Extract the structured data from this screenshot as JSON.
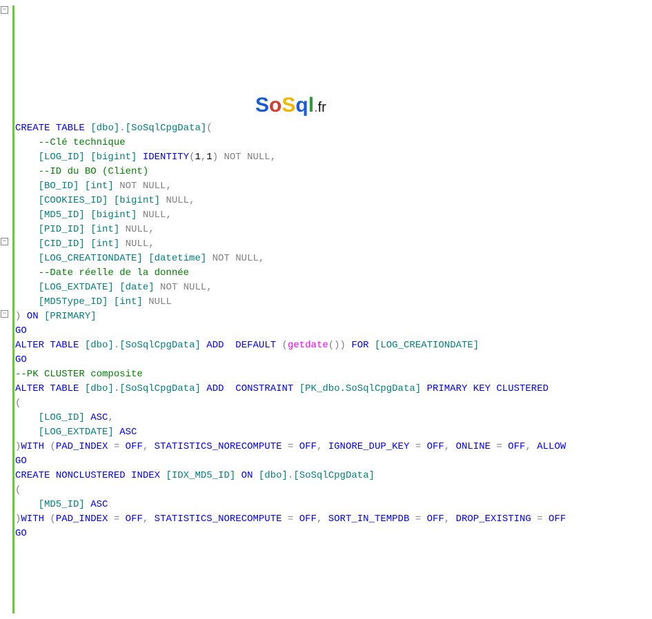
{
  "logo": {
    "s1": "S",
    "o": "o",
    "s2": "S",
    "q": "q",
    "l": "l",
    "dot": ".",
    "fr": "fr"
  },
  "code": {
    "l1a": "CREATE",
    "l1b": " TABLE",
    "l1c": " [dbo]",
    "l1d": ".",
    "l1e": "[SoSqlCpgData]",
    "l1f": "(",
    "l2": "    --Clé technique",
    "l3a": "    [LOG_ID] [bigint]",
    "l3b": " IDENTITY",
    "l3c": "(",
    "l3d": "1",
    "l3e": ",",
    "l3f": "1",
    "l3g": ")",
    "l3h": " NOT",
    "l3i": " NULL",
    "l3j": ",",
    "l4": "    --ID du BO (Client)",
    "l5a": "    [BO_ID] [int]",
    "l5b": " NOT",
    "l5c": " NULL",
    "l5d": ",",
    "l6a": "    [COOKIES_ID] [bigint]",
    "l6b": " NULL",
    "l6c": ",",
    "l7a": "    [MD5_ID] [bigint]",
    "l7b": " NULL",
    "l7c": ",",
    "l8a": "    [PID_ID] [int]",
    "l8b": " NULL",
    "l8c": ",",
    "l9a": "    [CID_ID] [int]",
    "l9b": " NULL",
    "l9c": ",",
    "l10a": "    [LOG_CREATIONDATE] [datetime]",
    "l10b": " NOT",
    "l10c": " NULL",
    "l10d": ",",
    "l11": "    --Date réelle de la donnée",
    "l12a": "    [LOG_EXTDATE] [date]",
    "l12b": " NOT",
    "l12c": " NULL",
    "l12d": ",",
    "l13a": "    [MD5Type_ID] [int]",
    "l13b": " NULL",
    "l14a": ")",
    "l14b": " ON",
    "l14c": " [PRIMARY]",
    "l15": "GO",
    "l16a": "ALTER",
    "l16b": " TABLE",
    "l16c": " [dbo]",
    "l16d": ".",
    "l16e": "[SoSqlCpgData]",
    "l16f": " ADD ",
    "l16g": " DEFAULT ",
    "l16h": "(",
    "l16i": "getdate",
    "l16j": "())",
    "l16k": " FOR",
    "l16l": " [LOG_CREATIONDATE]",
    "l17": "GO",
    "l18": "--PK CLUSTER composite",
    "l19a": "ALTER",
    "l19b": " TABLE",
    "l19c": " [dbo]",
    "l19d": ".",
    "l19e": "[SoSqlCpgData]",
    "l19f": " ADD ",
    "l19g": " CONSTRAINT",
    "l19h": " [PK_dbo.SoSqlCpgData]",
    "l19i": " PRIMARY",
    "l19j": " KEY",
    "l19k": " CLUSTERED",
    "l20": "(",
    "l21a": "    [LOG_ID]",
    "l21b": " ASC",
    "l21c": ",",
    "l22a": "    [LOG_EXTDATE]",
    "l22b": " ASC",
    "l23a": ")",
    "l23b": "WITH ",
    "l23c": "(",
    "l23d": "PAD_INDEX",
    "l23e": " =",
    "l23f": " OFF",
    "l23g": ",",
    "l23h": " STATISTICS_NORECOMPUTE",
    "l23i": " =",
    "l23j": " OFF",
    "l23k": ",",
    "l23l": " IGNORE_DUP_KEY",
    "l23m": " =",
    "l23n": " OFF",
    "l23o": ",",
    "l23p": " ONLINE",
    "l23q": " =",
    "l23r": " OFF",
    "l23s": ",",
    "l23t": " ALLOW",
    "l24": "GO",
    "l25a": "CREATE",
    "l25b": " NONCLUSTERED",
    "l25c": " INDEX",
    "l25d": " [IDX_MD5_ID]",
    "l25e": " ON",
    "l25f": " [dbo]",
    "l25g": ".",
    "l25h": "[SoSqlCpgData]",
    "l26": "(",
    "l27a": "    [MD5_ID]",
    "l27b": " ASC",
    "l28a": ")",
    "l28b": "WITH ",
    "l28c": "(",
    "l28d": "PAD_INDEX",
    "l28e": " =",
    "l28f": " OFF",
    "l28g": ",",
    "l28h": " STATISTICS_NORECOMPUTE",
    "l28i": " =",
    "l28j": " OFF",
    "l28k": ",",
    "l28l": " SORT_IN_TEMPDB",
    "l28m": " =",
    "l28n": " OFF",
    "l28o": ",",
    "l28p": " DROP_EXISTING",
    "l28q": " =",
    "l28r": " OFF",
    "l29": "GO"
  }
}
